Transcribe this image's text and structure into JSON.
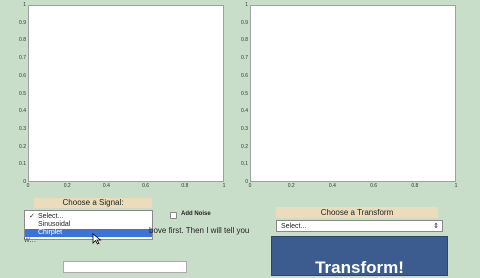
{
  "left_plot": {
    "y_ticks": [
      "1",
      "0.9",
      "0.8",
      "0.7",
      "0.6",
      "0.5",
      "0.4",
      "0.3",
      "0.2",
      "0.1",
      "0"
    ],
    "x_ticks": [
      "0",
      "0.2",
      "0.4",
      "0.6",
      "0.8",
      "1"
    ]
  },
  "right_plot": {
    "y_ticks": [
      "1",
      "0.9",
      "0.8",
      "0.7",
      "0.6",
      "0.5",
      "0.4",
      "0.3",
      "0.2",
      "0.1",
      "0"
    ],
    "x_ticks": [
      "0",
      "0.2",
      "0.4",
      "0.6",
      "0.8",
      "1"
    ]
  },
  "signal": {
    "label": "Choose a Signal:",
    "options": [
      "Select...",
      "Sinusoidal",
      "Chirplet"
    ],
    "checked_index": 0,
    "highlighted_index": 2,
    "check_mark": "✓"
  },
  "noise": {
    "label": "Add Noise",
    "checked": false
  },
  "instruction": {
    "line1": "bove first. Then I will tell you",
    "line2": "w..."
  },
  "transform": {
    "label": "Choose a Transform",
    "select_value": "Select...",
    "arrow": "⇕",
    "button_label": "Transform!"
  },
  "colors": {
    "background": "#c9dec9",
    "label_box": "#ecdcbc",
    "button": "#3c5b8e",
    "highlight": "#3b73d9"
  }
}
